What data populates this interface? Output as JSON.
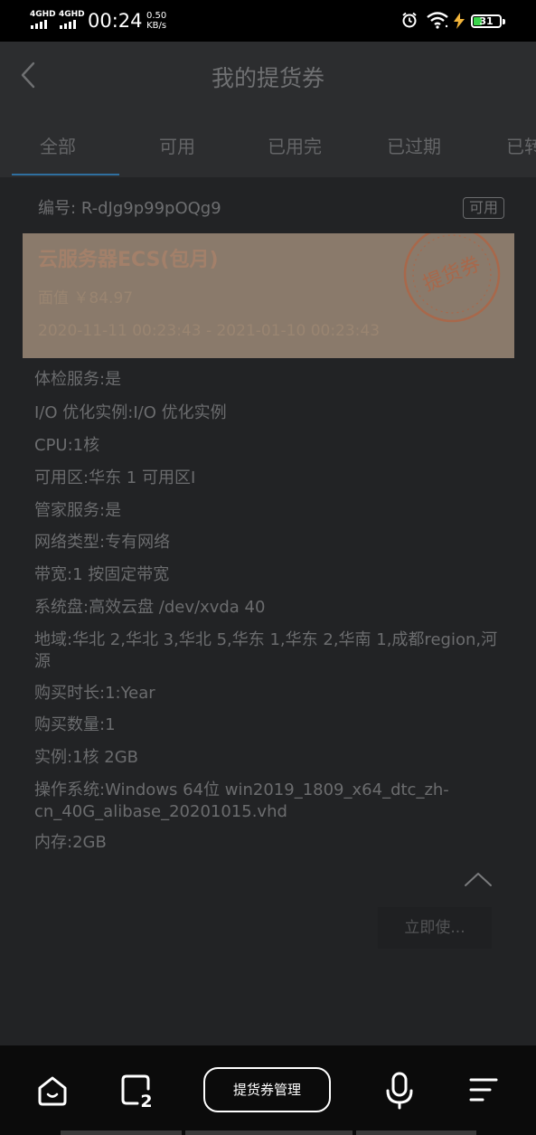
{
  "status_bar": {
    "sim1": "4GHD",
    "sim2": "4GHD",
    "time": "00:24",
    "speed_value": "0.50",
    "speed_unit": "KB/s",
    "battery": "31",
    "icons": [
      "signal-icon",
      "alarm-icon",
      "wifi-icon",
      "charging-icon",
      "battery-icon"
    ]
  },
  "header": {
    "title": "我的提货券",
    "back_icon": "chevron-left-icon"
  },
  "tabs": [
    {
      "label": "全部",
      "active": true
    },
    {
      "label": "可用",
      "active": false
    },
    {
      "label": "已用完",
      "active": false
    },
    {
      "label": "已过期",
      "active": false
    },
    {
      "label": "已转",
      "active": false
    }
  ],
  "voucher": {
    "code_label": "编号:",
    "code": "R-dJg9p99pOQg9",
    "status": "可用",
    "name": "云服务器ECS(包月)",
    "value_text": "面值 ￥84.97",
    "period": "2020-11-11 00:23:43 - 2021-01-10 00:23:43",
    "stamp_text": "提货券"
  },
  "details": [
    "体检服务:是",
    "I/O 优化实例:I/O 优化实例",
    "CPU:1核",
    "可用区:华东 1 可用区I",
    "管家服务:是",
    "网络类型:专有网络",
    "带宽:1 按固定带宽",
    "系统盘:高效云盘 /dev/xvda 40",
    "地域:华北 2,华北 3,华北 5,华东 1,华东 2,华南 1,成都region,河源",
    "购买时长:1:Year",
    "购买数量:1",
    "实例:1核 2GB",
    "操作系统:Windows 64位 win2019_1809_x64_dtc_zh-cn_40G_alibase_20201015.vhd",
    "内存:2GB"
  ],
  "actions": {
    "use_now": "立即使...",
    "collapse_icon": "chevron-up-icon"
  },
  "bottom_nav": {
    "home_icon": "home-icon",
    "tabs_icon": "tabs-icon",
    "tabs_count": "2",
    "center_button": "提货券管理",
    "mic_icon": "microphone-icon",
    "menu_icon": "menu-icon"
  }
}
